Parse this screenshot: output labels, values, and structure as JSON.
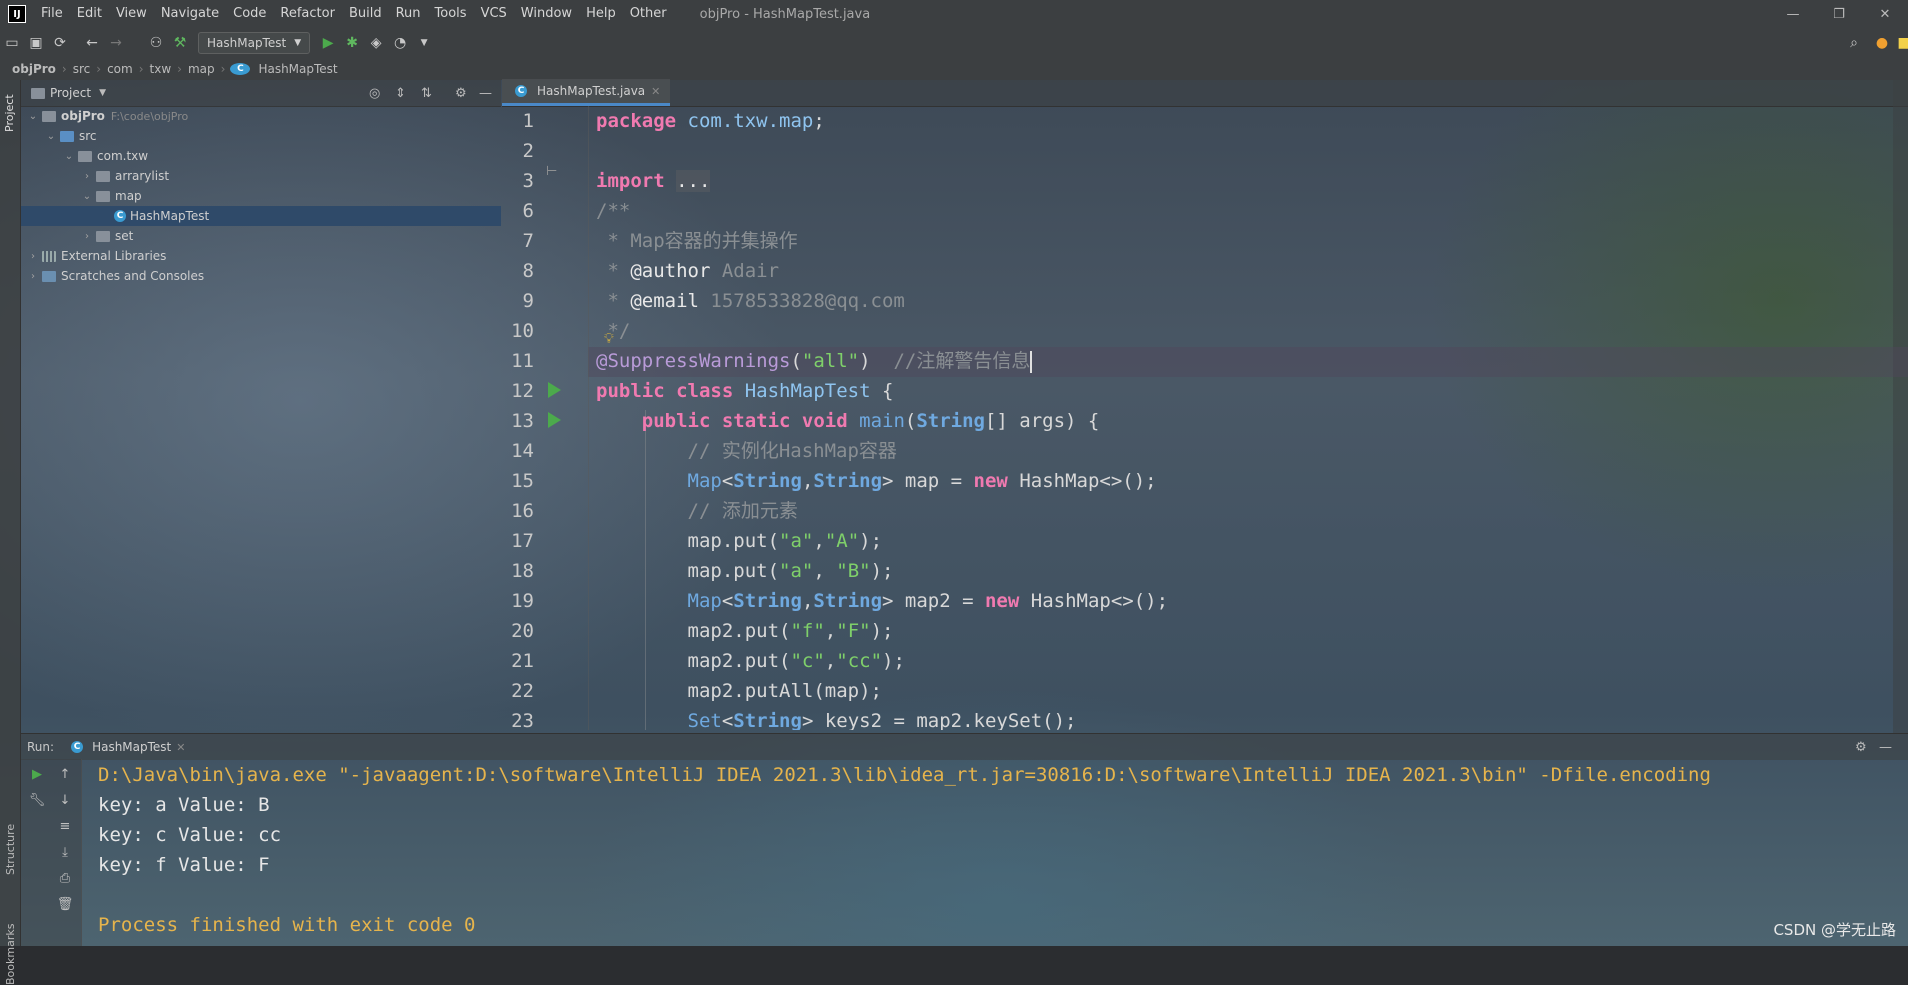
{
  "window": {
    "logo": "IJ",
    "title": "objPro - HashMapTest.java",
    "menu": [
      "File",
      "Edit",
      "View",
      "Navigate",
      "Code",
      "Refactor",
      "Build",
      "Run",
      "Tools",
      "VCS",
      "Window",
      "Help",
      "Other"
    ],
    "controls": [
      "—",
      "❐",
      "✕"
    ]
  },
  "toolbar": {
    "run_config": "HashMapTest"
  },
  "breadcrumb": [
    "objPro",
    "src",
    "com",
    "txw",
    "map",
    "HashMapTest"
  ],
  "project": {
    "header": "Project",
    "tree": [
      {
        "label": "objPro",
        "extra": "F:\\code\\objPro",
        "depth": 0,
        "expanded": true,
        "kind": "module"
      },
      {
        "label": "src",
        "depth": 1,
        "expanded": true,
        "kind": "src"
      },
      {
        "label": "com.txw",
        "depth": 2,
        "expanded": true,
        "kind": "pkg"
      },
      {
        "label": "arrarylist",
        "depth": 3,
        "expanded": false,
        "kind": "pkg"
      },
      {
        "label": "map",
        "depth": 3,
        "expanded": true,
        "kind": "pkg"
      },
      {
        "label": "HashMapTest",
        "depth": 4,
        "kind": "class",
        "selected": true
      },
      {
        "label": "set",
        "depth": 3,
        "expanded": false,
        "kind": "pkg"
      },
      {
        "label": "External Libraries",
        "depth": 0,
        "expanded": false,
        "kind": "lib"
      },
      {
        "label": "Scratches and Consoles",
        "depth": 0,
        "expanded": false,
        "kind": "scratch"
      }
    ]
  },
  "left_strip": [
    "Project",
    "Structure",
    "Bookmarks"
  ],
  "editor": {
    "tab": "HashMapTest.java",
    "line_numbers": [
      "1",
      "2",
      "3",
      "6",
      "7",
      "8",
      "9",
      "10",
      "11",
      "12",
      "13",
      "14",
      "15",
      "16",
      "17",
      "18",
      "19",
      "20",
      "21",
      "22",
      "23"
    ]
  },
  "run": {
    "label": "Run:",
    "tab": "HashMapTest",
    "output": [
      "D:\\Java\\bin\\java.exe \"-javaagent:D:\\software\\IntelliJ IDEA 2021.3\\lib\\idea_rt.jar=30816:D:\\software\\IntelliJ IDEA 2021.3\\bin\" -Dfile.encoding",
      "key: a Value: B",
      "key: c Value: cc",
      "key: f Value: F",
      "",
      "Process finished with exit code 0"
    ]
  },
  "watermark": "CSDN @学无止路"
}
